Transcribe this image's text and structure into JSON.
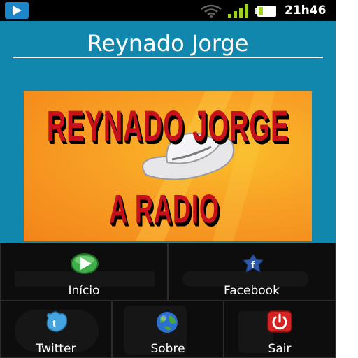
{
  "status_bar": {
    "time": "21h46"
  },
  "header": {
    "title": "Reynado Jorge"
  },
  "banner": {
    "line1": "REYNADO JORGE",
    "line2": "A RADIO"
  },
  "menu": {
    "items": [
      {
        "label": "Início",
        "icon": "play-icon"
      },
      {
        "label": "Facebook",
        "icon": "facebook-icon"
      },
      {
        "label": "Twitter",
        "icon": "twitter-icon"
      },
      {
        "label": "Sobre",
        "icon": "globe-icon"
      },
      {
        "label": "Sair",
        "icon": "power-icon"
      }
    ]
  },
  "colors": {
    "background": "#1187ad",
    "status_bar": "#000000",
    "menu_background": "#0d0d0d",
    "banner_orange": "#f8a025",
    "banner_text": "#c7111c"
  }
}
